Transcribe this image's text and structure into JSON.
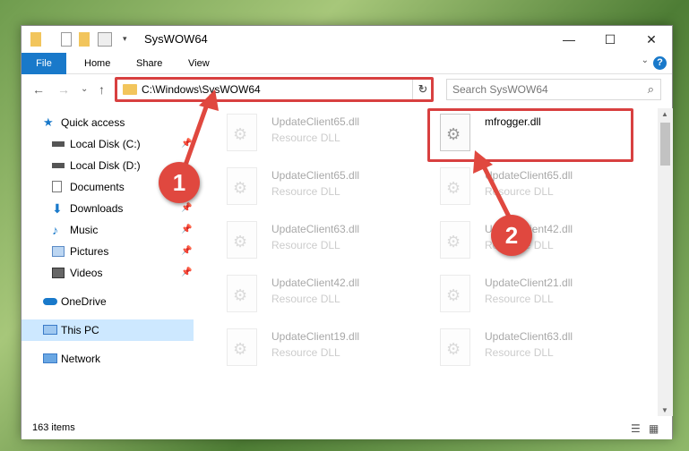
{
  "window": {
    "title": "SysWOW64",
    "minimize": "—",
    "maximize": "☐",
    "close": "✕"
  },
  "ribbon": {
    "tabs": [
      "File",
      "Home",
      "Share",
      "View"
    ],
    "help": "?",
    "collapse": "⌄"
  },
  "navigation": {
    "back": "←",
    "forward": "→",
    "recent": "⌄",
    "up": "↑",
    "address": "C:\\Windows\\SysWOW64",
    "address_dropdown": "⌄",
    "refresh": "↻",
    "search_placeholder": "Search SysWOW64",
    "search_icon": "⌕"
  },
  "sidebar": {
    "items": [
      {
        "label": "Quick access",
        "icon": "star-icon",
        "pinned": false
      },
      {
        "label": "Local Disk (C:)",
        "icon": "drive-icon",
        "pinned": true
      },
      {
        "label": "Local Disk (D:)",
        "icon": "drive-icon",
        "pinned": false
      },
      {
        "label": "Documents",
        "icon": "documents-icon",
        "pinned": true
      },
      {
        "label": "Downloads",
        "icon": "download-icon",
        "pinned": true
      },
      {
        "label": "Music",
        "icon": "music-icon",
        "pinned": true
      },
      {
        "label": "Pictures",
        "icon": "pictures-icon",
        "pinned": true
      },
      {
        "label": "Videos",
        "icon": "videos-icon",
        "pinned": true
      },
      {
        "label": "OneDrive",
        "icon": "cloud-icon",
        "pinned": false
      },
      {
        "label": "This PC",
        "icon": "pc-icon",
        "pinned": false,
        "selected": true
      },
      {
        "label": "Network",
        "icon": "network-icon",
        "pinned": false
      }
    ],
    "pin_glyph": "📌"
  },
  "files": [
    {
      "name": "UpdateClient65.dll",
      "type": "Resource DLL",
      "faded": true
    },
    {
      "name": "mfrogger.dll",
      "type": "",
      "faded": false,
      "highlighted": true
    },
    {
      "name": "UpdateClient65.dll",
      "type": "Resource DLL",
      "faded": true
    },
    {
      "name": "UpdateClient65.dll",
      "type": "Resource DLL",
      "faded": true
    },
    {
      "name": "UpdateClient63.dll",
      "type": "Resource DLL",
      "faded": true
    },
    {
      "name": "UpdateClient42.dll",
      "type": "Resource DLL",
      "faded": true
    },
    {
      "name": "UpdateClient42.dll",
      "type": "Resource DLL",
      "faded": true
    },
    {
      "name": "UpdateClient21.dll",
      "type": "Resource DLL",
      "faded": true
    },
    {
      "name": "UpdateClient19.dll",
      "type": "Resource DLL",
      "faded": true
    },
    {
      "name": "UpdateClient63.dll",
      "type": "Resource DLL",
      "faded": true
    }
  ],
  "status": {
    "count": "163 items",
    "details_view": "☰",
    "tiles_view": "▦"
  },
  "markers": [
    "1",
    "2"
  ],
  "colors": {
    "accent": "#1979ca",
    "highlight": "#d84040",
    "marker": "#e0483f",
    "selection": "#cde8ff"
  }
}
